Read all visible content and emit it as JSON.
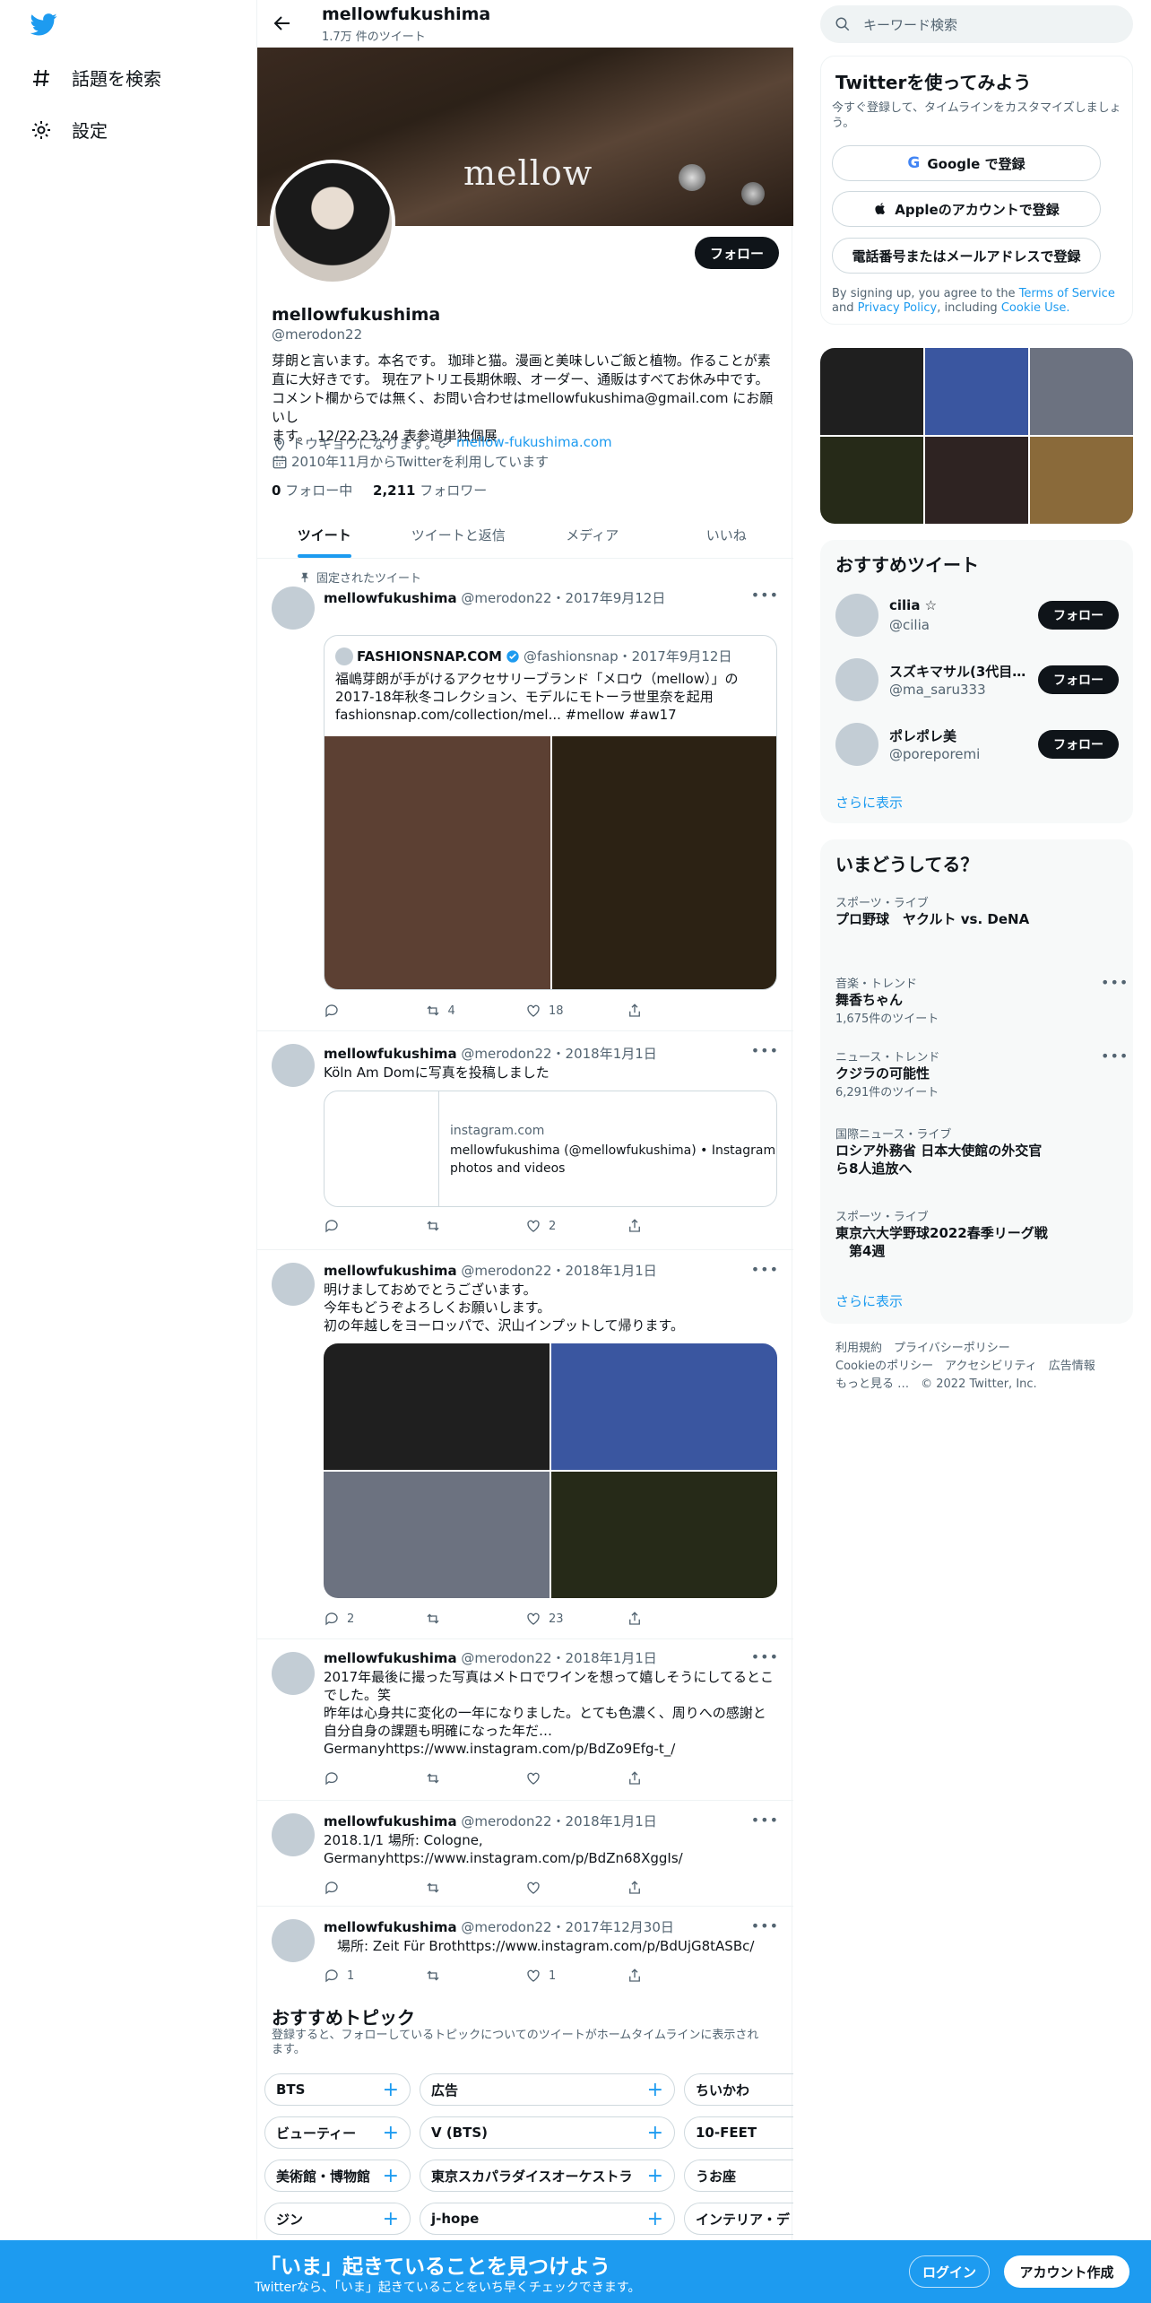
{
  "nav": {
    "explore": "話題を検索",
    "settings": "設定"
  },
  "header": {
    "title": "mellowfukushima",
    "subtitle": "1.7万 件のツイート"
  },
  "banner": {
    "word": "mellow"
  },
  "profile": {
    "follow": "フォロー",
    "name": "mellowfukushima",
    "handle": "@merodon22",
    "bio": [
      "芽朗と言います。本名です。 珈琲と猫。漫画と美味しいご飯と植物。作ることが素",
      "直に大好きです。 現在アトリエ長期休暇、オーダー、通販はすべてお休み中です。",
      "コメント欄からでは無く、お問い合わせはmellowfukushima@gmail.com にお願いし",
      "ます。　12/22.23.24 表参道単独個展"
    ],
    "location": "トウキョウになります。",
    "website": "mellow-fukushima.com",
    "joined": "2010年11月からTwitterを利用しています",
    "following_count": "0",
    "following_label": "フォロー中",
    "followers_count": "2,211",
    "followers_label": "フォロワー"
  },
  "tabs": [
    "ツイート",
    "ツイートと返信",
    "メディア",
    "いいね"
  ],
  "tweets": [
    {
      "pinned": "固定されたツイート",
      "name": "mellowfukushima",
      "meta": "@merodon22・2017年9月12日",
      "quote_name": "FASHIONSNAP.COM",
      "quote_meta": "@fashionsnap・2017年9月12日",
      "quote_text": [
        "福嶋芽朗が手がけるアクセサリーブランド「メロウ（mellow）」の",
        "2017-18年秋冬コレクション、モデルにモトーラ世里奈を起用",
        "fashionsnap.com/collection/mel... #mellow #aw17"
      ],
      "retweets": "4",
      "likes": "18"
    },
    {
      "name": "mellowfukushima",
      "meta": "@merodon22・2018年1月1日",
      "text": [
        "Köln Am Domに写真を投稿しました"
      ],
      "card_domain": "instagram.com",
      "card_title": [
        "mellowfukushima (@mellowfukushima) • Instagram",
        "photos and videos"
      ],
      "likes": "2"
    },
    {
      "name": "mellowfukushima",
      "meta": "@merodon22・2018年1月1日",
      "text": [
        "明けましておめでとうございます。",
        "今年もどうぞよろしくお願いします。",
        "初の年越しをヨーロッパで、沢山インプットして帰ります。"
      ],
      "replies": "2",
      "likes": "23"
    },
    {
      "name": "mellowfukushima",
      "meta": "@merodon22・2018年1月1日",
      "text": [
        "2017年最後に撮った写真はメトロでワインを想って嬉しそうにしてるとこ",
        "でした。笑",
        "昨年は心身共に変化の一年になりました。とても色濃く、周りへの感謝と",
        "自分自身の課題も明確になった年だ…",
        "Germanyhttps://www.instagram.com/p/BdZo9Efg-t_/"
      ]
    },
    {
      "name": "mellowfukushima",
      "meta": "@merodon22・2018年1月1日",
      "text": [
        "2018.1/1 場所: Cologne,",
        "Germanyhttps://www.instagram.com/p/BdZn68XggIs/"
      ]
    },
    {
      "name": "mellowfukushima",
      "meta": "@merodon22・2017年12月30日",
      "text": [
        "　場所: Zeit Für Brothttps://www.instagram.com/p/BdUjG8tASBc/"
      ],
      "replies": "1",
      "likes": "1"
    }
  ],
  "topics": {
    "title": "おすすめトピック",
    "subtitle": [
      "登録すると、フォローしているトピックについてのツイートがホームタイムラインに表示され",
      "ます。"
    ],
    "rows": [
      [
        "BTS",
        "広告",
        "ちいかわ"
      ],
      [
        "ビューティー",
        "V (BTS)",
        "10-FEET"
      ],
      [
        "美術館・博物館",
        "東京スカパラダイスオーケストラ",
        "うお座"
      ],
      [
        "ジン",
        "j-hope",
        "インテリア・デ"
      ]
    ]
  },
  "search": {
    "placeholder": "キーワード検索"
  },
  "signup": {
    "title": "Twitterを使ってみよう",
    "subtitle": [
      "今すぐ登録して、タイムラインをカスタマイズしましょ",
      "う。"
    ],
    "google": "Google で登録",
    "apple": "Appleのアカウントで登録",
    "phone": "電話番号またはメールアドレスで登録",
    "legal1": "By signing up, you agree to the ",
    "terms": "Terms of Service",
    "and": " and",
    "privacy": "Privacy Policy",
    "including": ", including ",
    "cookie": "Cookie Use."
  },
  "media_tiles": [
    "#1f1f1f",
    "#3a56a0",
    "#6c7280",
    "#262a18",
    "#2e2322",
    "#8a6a3a"
  ],
  "suggest": {
    "title": "おすすめツイート",
    "users": [
      {
        "name": "cilia ☆",
        "handle": "@cilia"
      },
      {
        "name": "スズキマサル(3代目…",
        "handle": "@ma_saru333"
      },
      {
        "name": "ポレポレ美",
        "handle": "@poreporemi"
      }
    ],
    "follow": "フォロー",
    "more": "さらに表示"
  },
  "trends": {
    "title": "いまどうしてる？",
    "items": [
      {
        "cat": "スポーツ・ライブ",
        "name": [
          "プロ野球　ヤクルト vs. DeNA"
        ],
        "count": ""
      },
      {
        "cat": "音楽・トレンド",
        "name": [
          "舞香ちゃん"
        ],
        "count": "1,675件のツイート"
      },
      {
        "cat": "ニュース・トレンド",
        "name": [
          "クジラの可能性"
        ],
        "count": "6,291件のツイート"
      },
      {
        "cat": "国際ニュース・ライブ",
        "name": [
          "ロシア外務省 日本大使館の外交官",
          "ら8人追放へ"
        ],
        "count": ""
      },
      {
        "cat": "スポーツ・ライブ",
        "name": [
          "東京六大学野球2022春季リーグ戦",
          "　第4週"
        ],
        "count": ""
      }
    ],
    "more": "さらに表示"
  },
  "footer": {
    "line1": "利用規約　プライバシーポリシー",
    "line2": "Cookieのポリシー　アクセシビリティ　広告情報",
    "line3": "もっと見る …　© 2022 Twitter, Inc."
  },
  "bottom": {
    "title": "「いま」起きていることを見つけよう",
    "subtitle": "Twitterなら、「いま」起きていることをいち早くチェックできます。",
    "login": "ログイン",
    "signup": "アカウント作成"
  },
  "colors": {
    "accent": "#1d9bf0",
    "text": "#0f1419",
    "muted": "#536471"
  }
}
